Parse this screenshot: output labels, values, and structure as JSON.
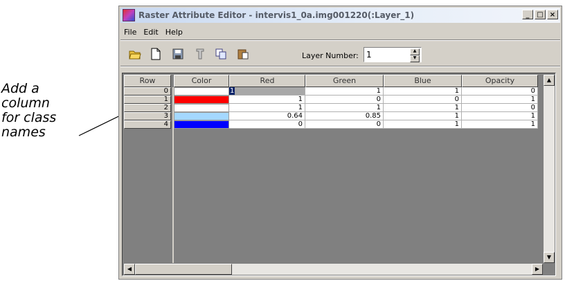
{
  "annotation": {
    "lines": [
      "Add a",
      "column",
      "for class",
      "names"
    ]
  },
  "window": {
    "title": "Raster Attribute Editor - intervis1_0a.img001220(:Layer_1)",
    "buttons": {
      "minimize": "_",
      "maximize": "□",
      "close": "×"
    }
  },
  "menu": {
    "items": [
      "File",
      "Edit",
      "Help"
    ]
  },
  "toolbar": {
    "icons": [
      "open-folder-icon",
      "new-document-icon",
      "save-icon",
      "query-icon",
      "copy-icon",
      "paste-icon"
    ],
    "layer_label": "Layer Number:",
    "layer_value": "1"
  },
  "table": {
    "headers": [
      "Row",
      "Color",
      "Red",
      "Green",
      "Blue",
      "Opacity"
    ],
    "rows": [
      {
        "row": "0",
        "color": "#ffffff",
        "red": "1",
        "green": "1",
        "blue": "1",
        "opacity": "0"
      },
      {
        "row": "1",
        "color": "#ff0000",
        "red": "1",
        "green": "0",
        "blue": "0",
        "opacity": "1"
      },
      {
        "row": "2",
        "color": "#ffffff",
        "red": "1",
        "green": "1",
        "blue": "1",
        "opacity": "0"
      },
      {
        "row": "3",
        "color": "#a4d8ff",
        "red": "0.64",
        "green": "0.85",
        "blue": "1",
        "opacity": "1"
      },
      {
        "row": "4",
        "color": "#0000ff",
        "red": "0",
        "green": "0",
        "blue": "1",
        "opacity": "1"
      }
    ],
    "selected_cell": {
      "row": 0,
      "column": "red"
    }
  }
}
